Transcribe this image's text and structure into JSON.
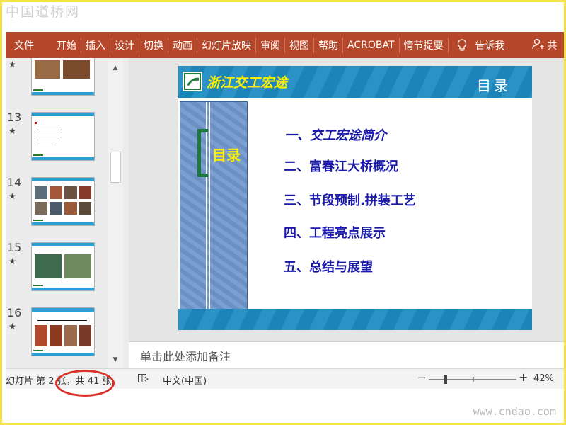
{
  "watermark_top": "中国道桥网",
  "watermark_bottom": "www.cndao.com",
  "ribbon": {
    "tabs": [
      "文件",
      "开始",
      "插入",
      "设计",
      "切换",
      "动画",
      "幻灯片放映",
      "审阅",
      "视图",
      "帮助",
      "ACROBAT",
      "情节提要"
    ],
    "tell_me": "告诉我",
    "share": "共",
    "accent_color": "#b7472a"
  },
  "thumbnails": [
    {
      "num": "13",
      "star": "★"
    },
    {
      "num": "14",
      "star": "★"
    },
    {
      "num": "15",
      "star": "★"
    },
    {
      "num": "16",
      "star": "★"
    }
  ],
  "top_partial_star": "★",
  "slide": {
    "brand": "浙江交工宏途",
    "header_title": "目录",
    "side_label": "目录",
    "items": [
      "一、交工宏途简介",
      "二、富春江大桥概况",
      "三、节段预制.拼装工艺",
      "四、工程亮点展示",
      "五、总结与展望"
    ],
    "header_color": "#1e8bc3",
    "item_color": "#1a1aa8"
  },
  "notes_placeholder": "单击此处添加备注",
  "status": {
    "slide_info": "幻灯片 第 2 张，共 41 张",
    "language": "中文(中国)",
    "zoom": "42%"
  }
}
